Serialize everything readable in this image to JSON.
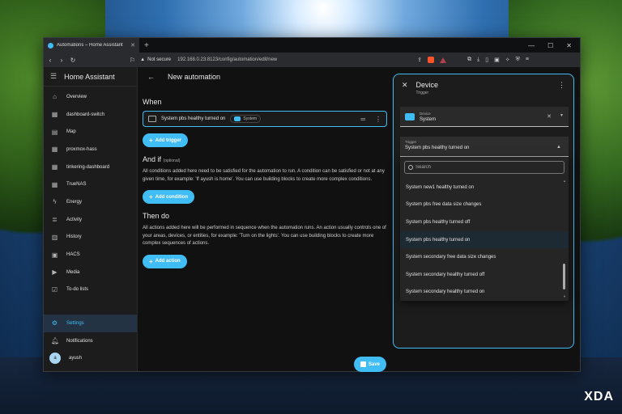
{
  "browser": {
    "tab_title": "Automations – Home Assistant",
    "security_label": "Not secure",
    "url": "192.168.0.23:8123/config/automation/edit/new"
  },
  "sidebar": {
    "title": "Home Assistant",
    "items": [
      {
        "label": "Overview",
        "icon": "home-icon"
      },
      {
        "label": "dashboard-switch",
        "icon": "dashboard-icon"
      },
      {
        "label": "Map",
        "icon": "map-icon"
      },
      {
        "label": "proxmox-hass",
        "icon": "dashboard-icon"
      },
      {
        "label": "tinkering-dashboard",
        "icon": "dashboard-icon"
      },
      {
        "label": "TrueNAS",
        "icon": "dashboard-icon"
      },
      {
        "label": "Energy",
        "icon": "lightning-icon"
      },
      {
        "label": "Activity",
        "icon": "list-icon"
      },
      {
        "label": "History",
        "icon": "chart-icon"
      },
      {
        "label": "HACS",
        "icon": "hacs-icon"
      },
      {
        "label": "Media",
        "icon": "media-icon"
      },
      {
        "label": "To-do lists",
        "icon": "clipboard-icon"
      }
    ],
    "bottom": {
      "settings": "Settings",
      "notifications": "Notifications",
      "user_initial": "a",
      "user_name": "ayush"
    }
  },
  "toolbar": {
    "title": "New automation"
  },
  "editor": {
    "when_heading": "When",
    "trigger_text": "System pbs healthy turned on",
    "trigger_chip": "System",
    "add_trigger": "Add trigger",
    "and_if_heading": "And if",
    "and_if_note": "(optional)",
    "and_if_desc": "All conditions added here need to be satisfied for the automation to run. A condition can be satisfied or not at any given time, for example: 'If ayush is home'. You can use building blocks to create more complex conditions.",
    "add_condition": "Add condition",
    "then_heading": "Then do",
    "then_desc": "All actions added here will be performed in sequence when the automation runs. An action usually controls one of your areas, devices, or entities, for example: 'Turn on the lights'. You can use building blocks to create more complex sequences of actions.",
    "add_action": "Add action",
    "save": "Save"
  },
  "panel": {
    "title": "Device",
    "subtitle": "Trigger",
    "device_label": "Device",
    "device_value": "System",
    "trigger_label": "Trigger",
    "trigger_value": "System pbs healthy turned on",
    "search_placeholder": "Search",
    "options": [
      "System new1 healthy turned on",
      "System pbs free data size changes",
      "System pbs healthy turned off",
      "System pbs healthy turned on",
      "System secondary free data size changes",
      "System secondary healthy turned off",
      "System secondary healthy turned on"
    ],
    "selected_index": 3
  },
  "watermark": "XDA",
  "colors": {
    "accent": "#41bdf5",
    "background": "#111111",
    "sidebar": "#1c1c1c"
  }
}
